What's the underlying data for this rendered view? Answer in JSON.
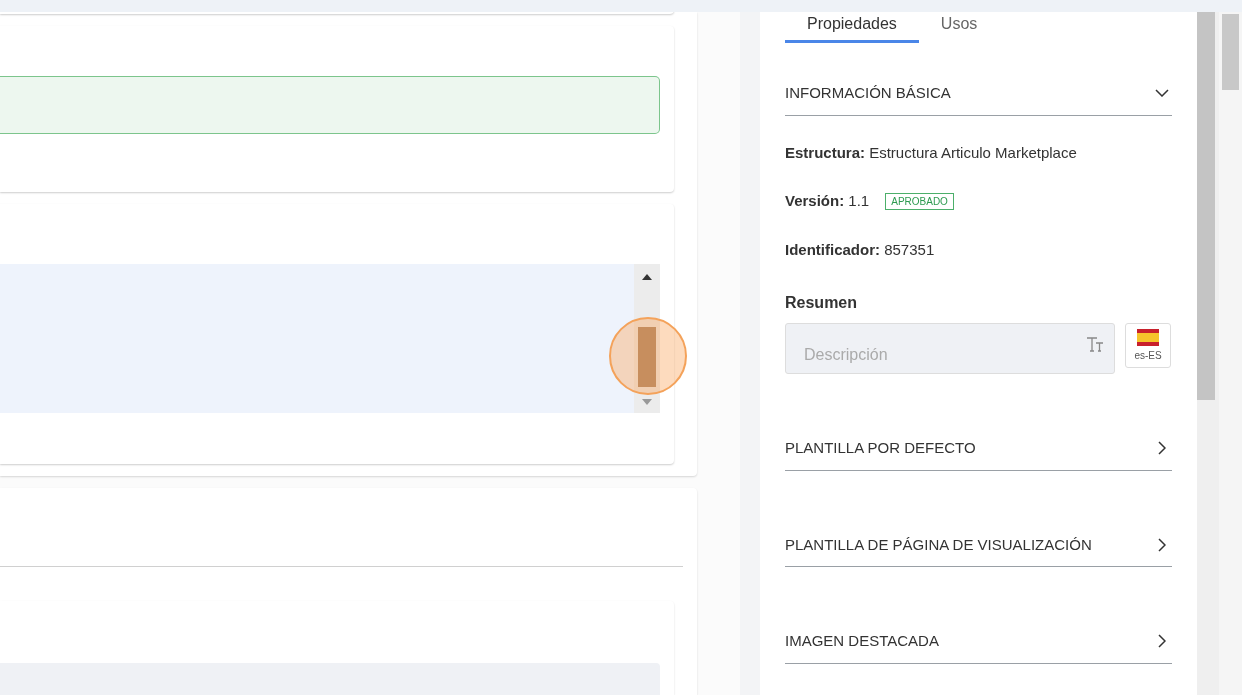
{
  "tabs": [
    {
      "label": "Propiedades",
      "selected": true
    },
    {
      "label": "Usos",
      "selected": false
    }
  ],
  "sections": [
    {
      "title": "INFORMACIÓN BÁSICA",
      "expanded": true
    },
    {
      "title": "PLANTILLA POR DEFECTO",
      "expanded": false
    },
    {
      "title": "PLANTILLA DE PÁGINA DE VISUALIZACIÓN",
      "expanded": false
    },
    {
      "title": "IMAGEN DESTACADA",
      "expanded": false
    }
  ],
  "basic_info": [
    {
      "text": "**Estructura:** Estructura Articulo Marketplace"
    },
    {
      "text": "**Versión:** 1.1",
      "badge": "APROBADO"
    },
    {
      "text": "**Identificador:** 857351"
    }
  ],
  "summary": {
    "label": "Resumen",
    "placeholder": "Descripción",
    "locale": "es-ES"
  }
}
